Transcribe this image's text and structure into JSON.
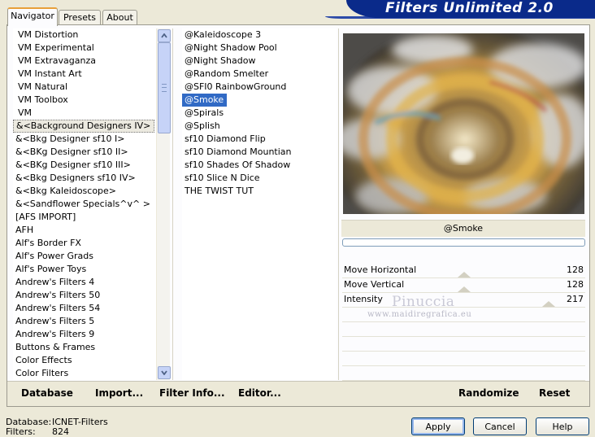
{
  "banner_title": "Filters Unlimited 2.0",
  "tabs": [
    "Navigator",
    "Presets",
    "About"
  ],
  "categories": [
    "VM Distortion",
    "VM Experimental",
    "VM Extravaganza",
    "VM Instant Art",
    "VM Natural",
    "VM Toolbox",
    "VM",
    "&<Background Designers IV>",
    "&<Bkg Designer sf10 I>",
    "&<BKg Designer sf10 II>",
    "&<BKg Designer sf10 III>",
    "&<Bkg Designers sf10 IV>",
    "&<Bkg Kaleidoscope>",
    "&<Sandflower Specials^v^ >",
    "[AFS IMPORT]",
    "AFH",
    "Alf's Border FX",
    "Alf's Power Grads",
    "Alf's Power Toys",
    "Andrew's Filters 4",
    "Andrew's Filters 50",
    "Andrew's Filters 54",
    "Andrew's Filters 5",
    "Andrew's Filters 9",
    "Buttons & Frames",
    "Color Effects",
    "Color Filters"
  ],
  "highlighted_category_index": 7,
  "filters": [
    "@Kaleidoscope 3",
    "@Night Shadow Pool",
    "@Night Shadow",
    "@Random Smelter",
    "@SFI0 RainbowGround",
    "@Smoke",
    "@Spirals",
    "@Splish",
    "sf10 Diamond Flip",
    "sf10 Diamond Mountian",
    "sf10 Shades Of Shadow",
    "sf10 Slice N Dice",
    "THE TWIST TUT"
  ],
  "selected_filter_index": 5,
  "selected_filter_name": "@Smoke",
  "params": [
    {
      "label": "Move Horizontal",
      "value": "128",
      "level": 0.5
    },
    {
      "label": "Move Vertical",
      "value": "128",
      "level": 0.5
    },
    {
      "label": "Intensity",
      "value": "217",
      "level": 0.85
    }
  ],
  "watermark": {
    "name": "Pinuccia",
    "url": "www.maidiregrafica.eu"
  },
  "panel_buttons": {
    "database": "Database",
    "import": "Import...",
    "filter_info": "Filter Info...",
    "editor": "Editor...",
    "randomize": "Randomize",
    "reset": "Reset"
  },
  "footer": {
    "database_label": "Database:",
    "database_value": "ICNET-Filters",
    "filters_label": "Filters:",
    "filters_value": "824"
  },
  "dialog_buttons": {
    "apply": "Apply",
    "cancel": "Cancel",
    "help": "Help"
  }
}
